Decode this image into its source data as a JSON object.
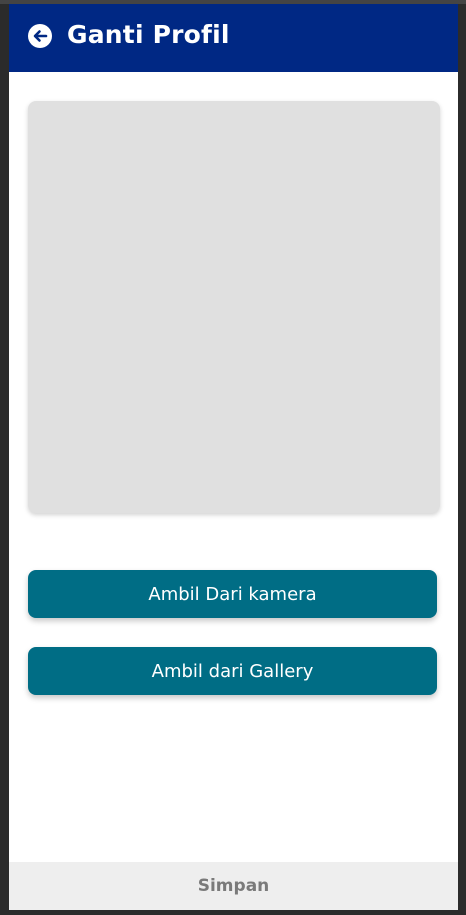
{
  "header": {
    "title": "Ganti Profil",
    "back_icon": "arrow-left-circle-icon",
    "background_color": "#002884"
  },
  "photo": {
    "placeholder_color": "#e0e0e0"
  },
  "actions": {
    "camera_label": "Ambil Dari kamera",
    "gallery_label": "Ambil dari Gallery",
    "button_color": "#006d85"
  },
  "footer": {
    "save_label": "Simpan"
  }
}
